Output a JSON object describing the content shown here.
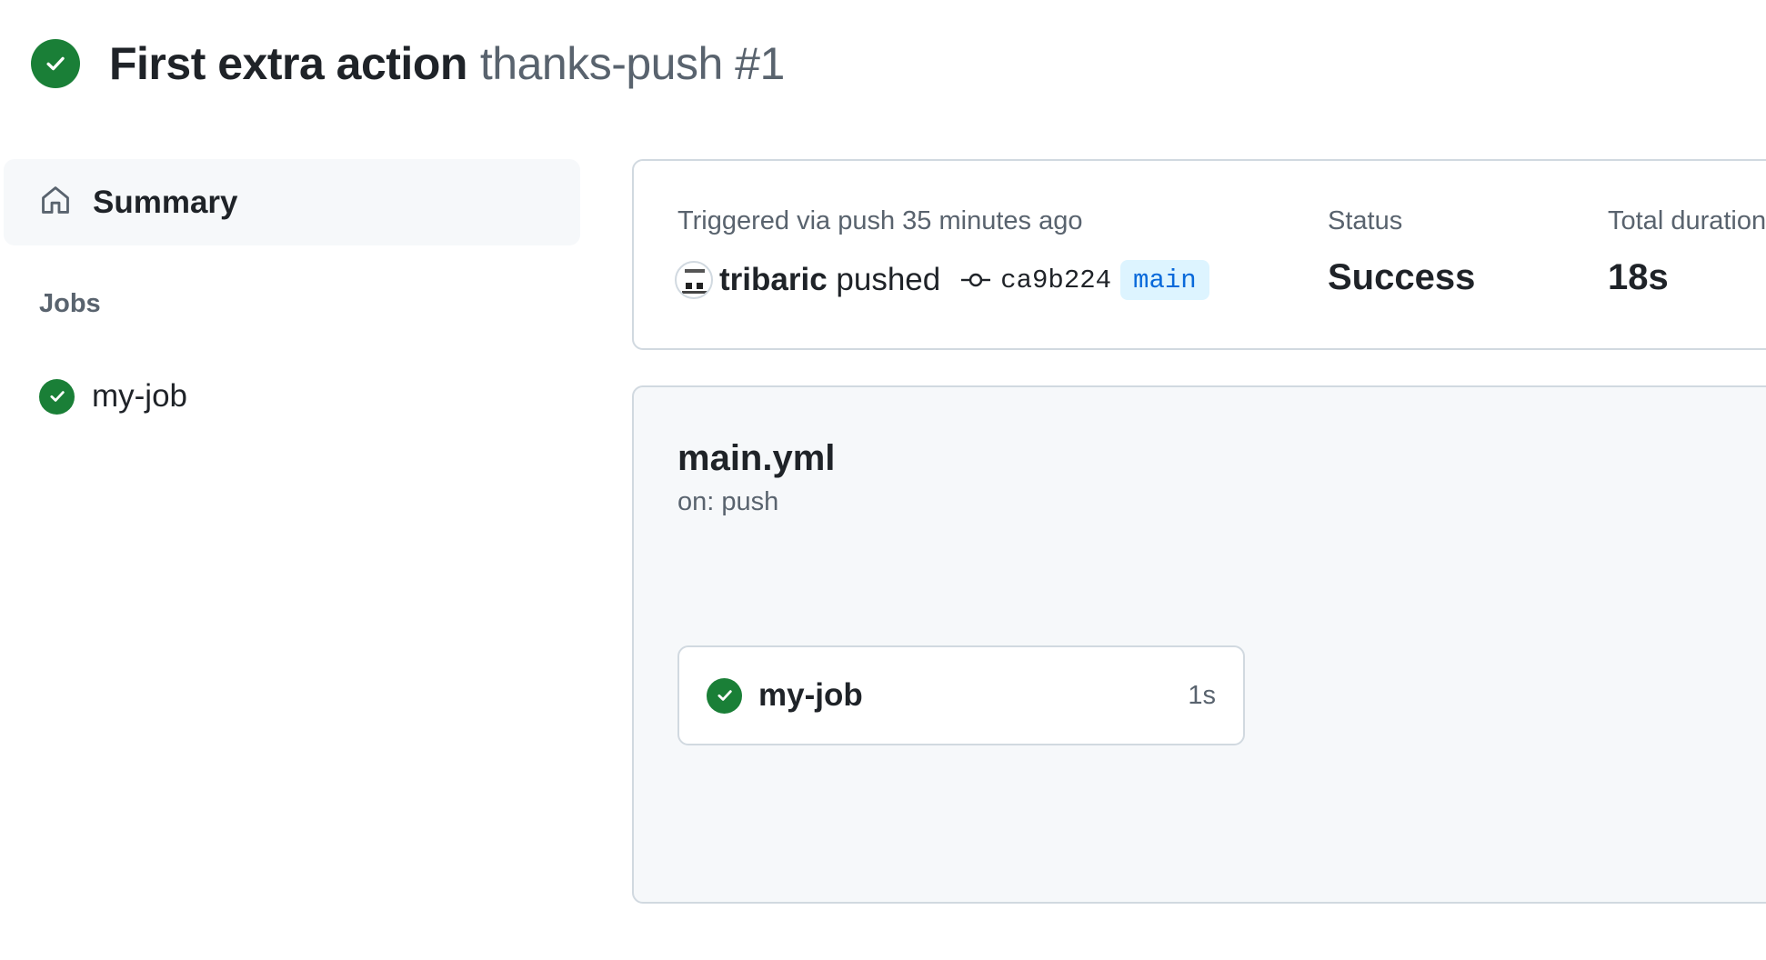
{
  "header": {
    "workflow_name": "First extra action",
    "run_label": "thanks-push #1",
    "status_icon": "check-circle-fill-icon",
    "status_color": "#1a7f37"
  },
  "sidebar": {
    "summary_label": "Summary",
    "summary_icon": "home-icon",
    "jobs_heading": "Jobs",
    "jobs": [
      {
        "label": "my-job",
        "status": "success"
      }
    ]
  },
  "run_info": {
    "trigger_text": "Triggered via push 35 minutes ago",
    "actor": "tribaric",
    "action": "pushed",
    "commit_sha": "ca9b224",
    "branch": "main",
    "status_label": "Status",
    "status_value": "Success",
    "duration_label": "Total duration",
    "duration_value": "18s"
  },
  "workflow_graph": {
    "file_name": "main.yml",
    "trigger": "on: push",
    "jobs": [
      {
        "name": "my-job",
        "duration": "1s",
        "status": "success"
      }
    ]
  },
  "colors": {
    "success": "#1a7f37",
    "branch_bg": "#ddf4ff",
    "branch_fg": "#0969da",
    "muted": "#59636e",
    "border": "#d1d9e0",
    "panel_bg": "#f6f8fa"
  }
}
